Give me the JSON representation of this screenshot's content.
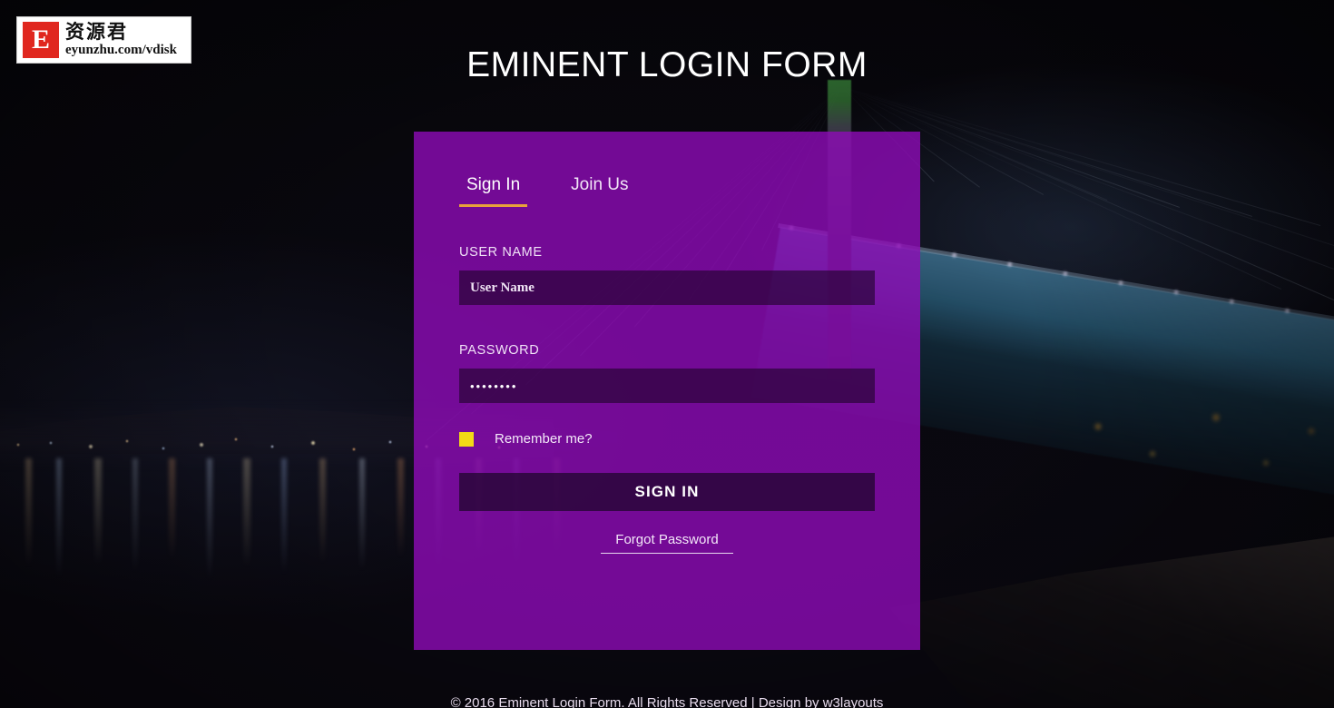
{
  "watermark": {
    "mark_letter": "E",
    "cn_text": "资源君",
    "url_text": "eyunzhu.com/vdisk"
  },
  "page": {
    "title": "EMINENT LOGIN FORM"
  },
  "panel": {
    "tabs": [
      {
        "label": "Sign In",
        "active": true
      },
      {
        "label": "Join Us",
        "active": false
      }
    ],
    "username": {
      "label": "USER NAME",
      "placeholder": "User Name",
      "value": ""
    },
    "password": {
      "label": "PASSWORD",
      "placeholder": "",
      "value": "••••••••"
    },
    "remember": {
      "label": "Remember me?",
      "checked": true
    },
    "submit_label": "SIGN IN",
    "forgot_label": "Forgot Password"
  },
  "footer": {
    "text": "© 2016 Eminent Login Form. All Rights Reserved | Design by ",
    "link": "w3layouts"
  },
  "colors": {
    "panel": "#8f0bb8",
    "accent_underline": "#e8a23a",
    "checkbox": "#f2d916",
    "input_fill": "#1e042a",
    "logo_red": "#e0271f"
  }
}
